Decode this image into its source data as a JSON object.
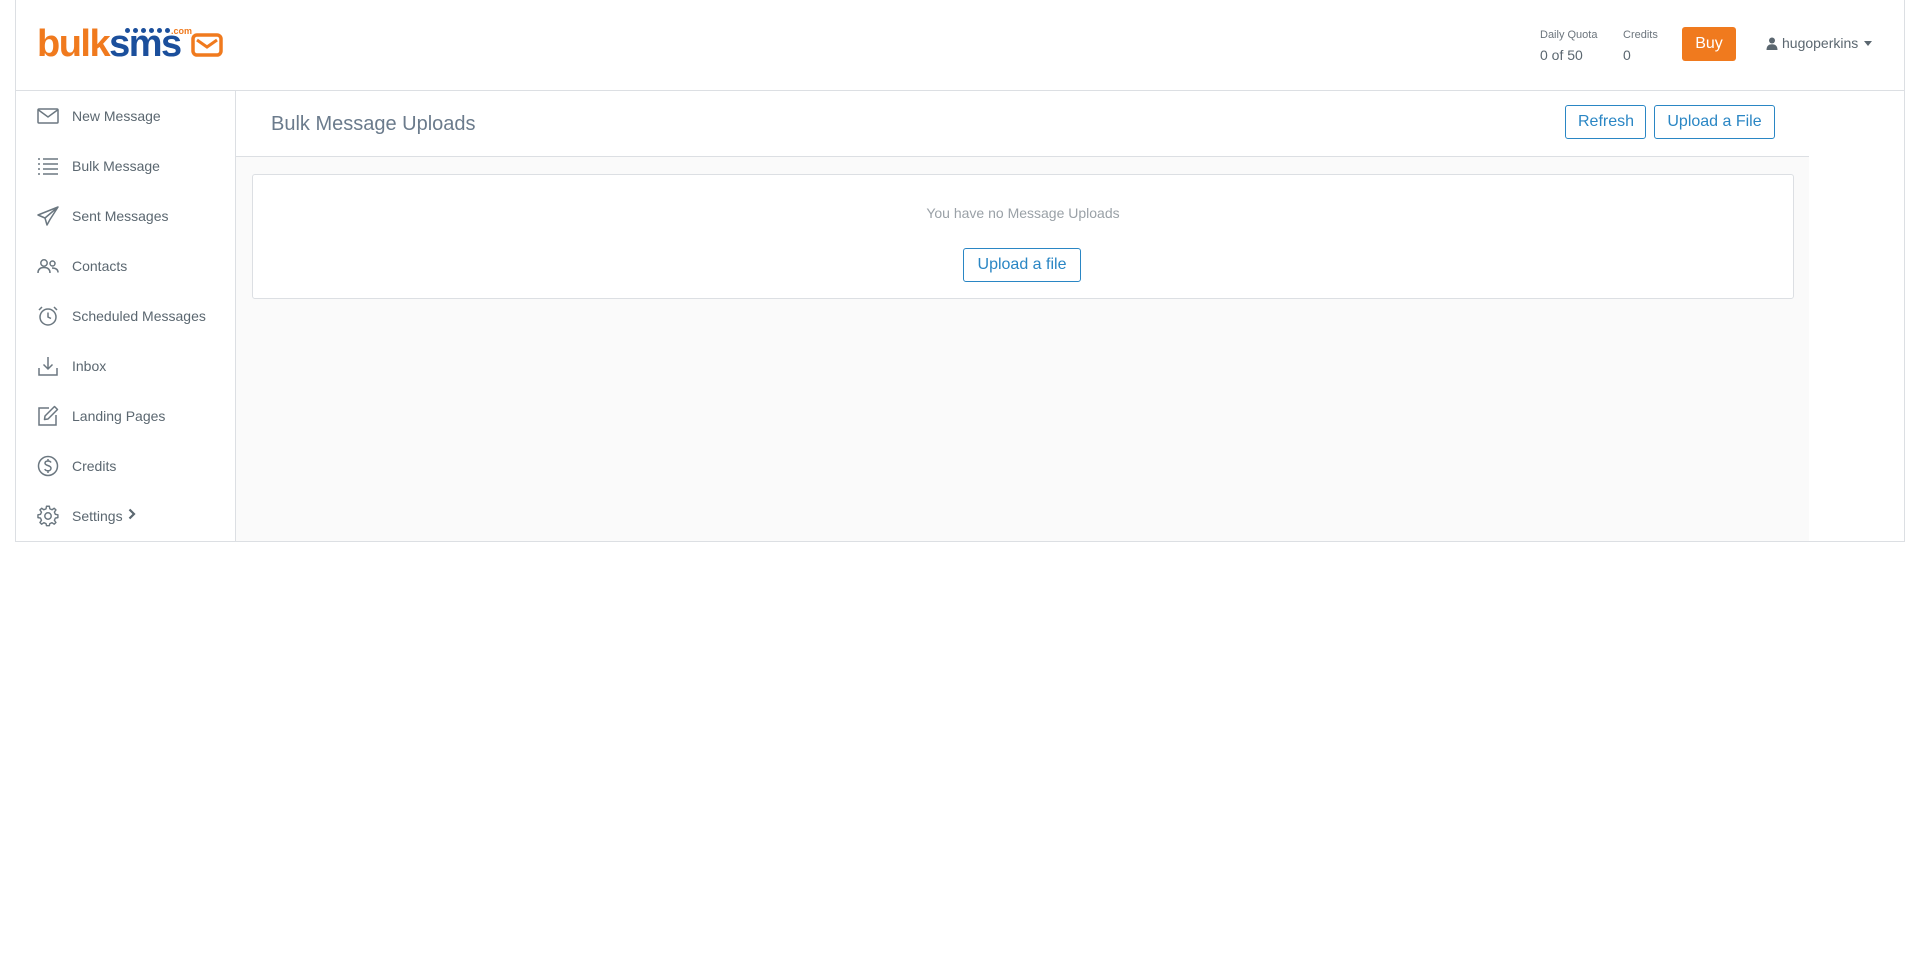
{
  "header": {
    "logo": {
      "part1": "bulk",
      "part2": "sms",
      "suffix": ".com"
    },
    "daily_quota": {
      "label": "Daily Quota",
      "value": "0 of 50"
    },
    "credits": {
      "label": "Credits",
      "value": "0"
    },
    "buy_label": "Buy",
    "username": "hugoperkins"
  },
  "sidebar": {
    "items": [
      {
        "label": "New Message",
        "icon": "envelope-icon"
      },
      {
        "label": "Bulk Message",
        "icon": "list-icon"
      },
      {
        "label": "Sent Messages",
        "icon": "paper-plane-icon"
      },
      {
        "label": "Contacts",
        "icon": "users-icon"
      },
      {
        "label": "Scheduled Messages",
        "icon": "alarm-clock-icon"
      },
      {
        "label": "Inbox",
        "icon": "inbox-download-icon"
      },
      {
        "label": "Landing Pages",
        "icon": "edit-square-icon"
      },
      {
        "label": "Credits",
        "icon": "dollar-circle-icon"
      },
      {
        "label": "Settings",
        "icon": "gear-icon"
      }
    ]
  },
  "main": {
    "title": "Bulk Message Uploads",
    "refresh_label": "Refresh",
    "upload_label": "Upload a File",
    "empty_message": "You have no Message Uploads",
    "empty_upload_label": "Upload a file"
  },
  "colors": {
    "accent": "#2a86c4",
    "brand_orange": "#f07a1e",
    "brand_blue": "#1b4f9c",
    "border": "#dcdfe3"
  }
}
